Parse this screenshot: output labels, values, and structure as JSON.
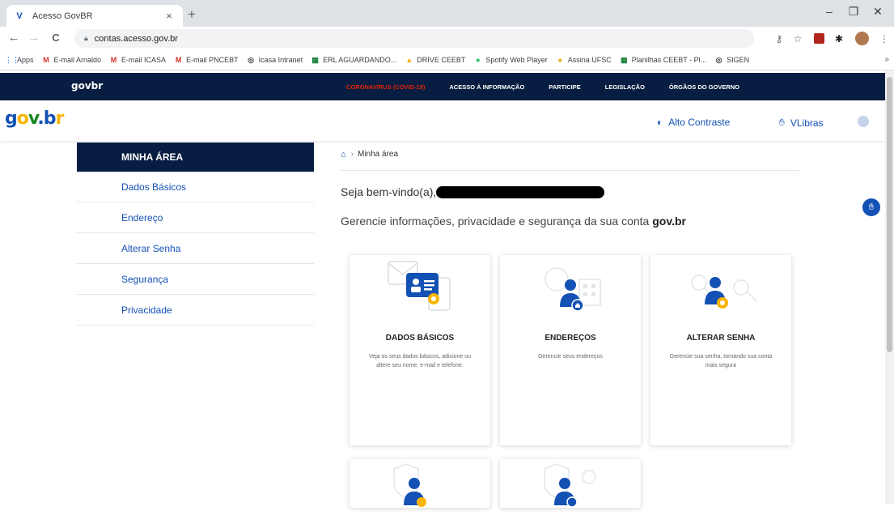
{
  "browser": {
    "tab_title": "Acesso GovBR",
    "tab_close": "×",
    "new_tab": "+",
    "url": "contas.acesso.gov.br",
    "minimize": "–",
    "restore": "❐",
    "close": "✕",
    "back": "←",
    "forward": "→",
    "reload": "C",
    "bookmarks": [
      {
        "icon": "apps-icon",
        "label": "Apps",
        "color": "#4285f4",
        "glyph": "⋮⋮"
      },
      {
        "icon": "gmail-icon",
        "label": "E-mail Arnaldo",
        "color": "#d93025",
        "glyph": "M"
      },
      {
        "icon": "gmail-icon",
        "label": "E-mail ICASA",
        "color": "#d93025",
        "glyph": "M"
      },
      {
        "icon": "gmail-icon",
        "label": "E-mail PNCEBT",
        "color": "#d93025",
        "glyph": "M"
      },
      {
        "icon": "globe-icon",
        "label": "Icasa Intranet",
        "color": "#444444",
        "glyph": "◎"
      },
      {
        "icon": "sheets-icon",
        "label": "ERL AGUARDANDO...",
        "color": "#188038",
        "glyph": "▦"
      },
      {
        "icon": "drive-icon",
        "label": "DRIVE CEEBT",
        "color": "#f9ab00",
        "glyph": "▲"
      },
      {
        "icon": "spotify-icon",
        "label": "Spotify Web Player",
        "color": "#1db954",
        "glyph": "●"
      },
      {
        "icon": "assina-icon",
        "label": "Assina UFSC",
        "color": "#e8a400",
        "glyph": "♠"
      },
      {
        "icon": "sheets-icon",
        "label": "Planilhas CEEBT - Pl...",
        "color": "#188038",
        "glyph": "▦"
      },
      {
        "icon": "globe-icon",
        "label": "SIGEN",
        "color": "#444444",
        "glyph": "◎"
      }
    ],
    "bookmarks_more": "»"
  },
  "govbar": {
    "logo": "govbr",
    "links": [
      "CORONAVÍRUS (COVID-19)",
      "ACESSO À INFORMAÇÃO",
      "PARTICIPE",
      "LEGISLAÇÃO",
      "ÓRGÃOS DO GOVERNO"
    ]
  },
  "header": {
    "logo_parts": [
      "g",
      "o",
      "v",
      ".",
      "b",
      "r"
    ],
    "alto_contraste": "Alto Contraste",
    "vlibras": "VLibras"
  },
  "menu": {
    "head": "MINHA ÁREA",
    "items": [
      "Dados Básicos",
      "Endereço",
      "Alterar Senha",
      "Segurança",
      "Privacidade"
    ]
  },
  "main": {
    "breadcrumb": "Minha área",
    "breadcrumb_sep": "›",
    "welcome": "Seja bem-vindo(a),",
    "subtitle_prefix": "Gerencie informações, privacidade e segurança da sua conta ",
    "subtitle_brand": "gov.br",
    "cards": [
      {
        "title": "DADOS BÁSICOS",
        "desc": "Veja os seus dados básicos, adicione ou altere seu nome, e-mail e telefone."
      },
      {
        "title": "ENDEREÇOS",
        "desc": "Gerencie seus endereços"
      },
      {
        "title": "ALTERAR SENHA",
        "desc": "Gerencie sua senha, tornando sua conta mais segura"
      }
    ]
  },
  "colors": {
    "primary_blue": "#1351b4",
    "dark_blue": "#071d41",
    "accent_yellow": "#f8b400",
    "covid_red": "#e52207"
  }
}
